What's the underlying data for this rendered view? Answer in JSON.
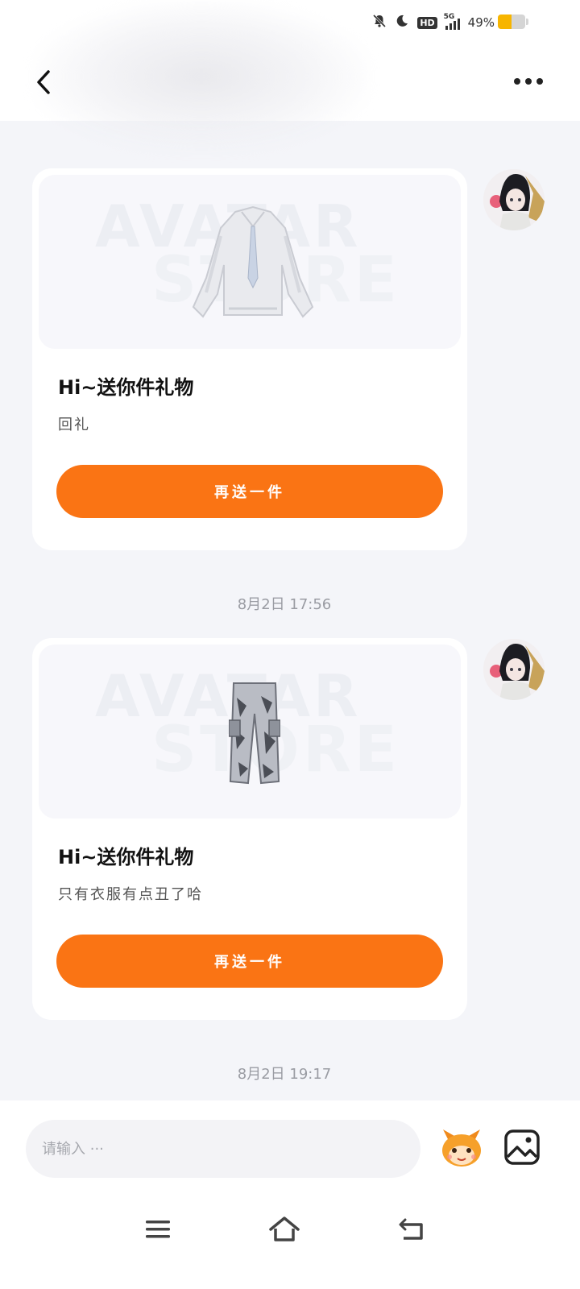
{
  "status_bar": {
    "network": "5G",
    "hd_badge": "HD",
    "battery_text": "49%",
    "battery_level": 0.49,
    "icons": [
      "mute-bell-icon",
      "moon-icon",
      "hd-icon",
      "signal-icon",
      "battery-icon"
    ]
  },
  "header": {
    "back_icon": "chevron-left-icon",
    "more_icon": "more-dots-icon"
  },
  "messages": [
    {
      "title": "Hi~送你件礼物",
      "subtitle": "回礼",
      "button_label": "再送一件",
      "product": "shirt",
      "watermark_top": "AVATAR",
      "watermark_bottom": "STORE"
    },
    {
      "title": "Hi~送你件礼物",
      "subtitle": "只有衣服有点丑了哈",
      "button_label": "再送一件",
      "product": "cargo-pants",
      "watermark_top": "AVATAR",
      "watermark_bottom": "STORE"
    }
  ],
  "timestamps": [
    "8月2日 17:56",
    "8月2日 19:17"
  ],
  "input": {
    "placeholder": "请输入 ···",
    "emoji_icon": "fox-mascot-icon",
    "image_icon": "image-icon"
  },
  "nav": [
    "menu-icon",
    "home-icon",
    "back-icon"
  ],
  "colors": {
    "accent": "#fa7414",
    "page_bg": "#f4f5f9",
    "battery": "#f7b500"
  }
}
